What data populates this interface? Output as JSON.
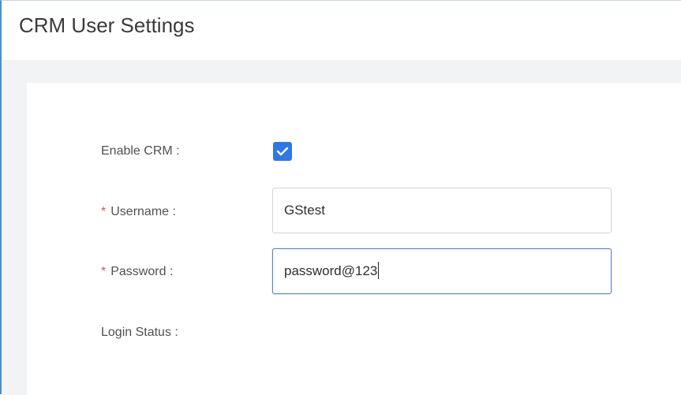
{
  "header": {
    "title": "CRM User Settings"
  },
  "form": {
    "enable_crm": {
      "label": "Enable CRM :",
      "checked": true
    },
    "username": {
      "required_mark": "*",
      "label": "Username :",
      "value": "GStest"
    },
    "password": {
      "required_mark": "*",
      "label": "Password :",
      "value": "password@123"
    },
    "login_status": {
      "label": "Login Status :"
    }
  },
  "colors": {
    "accent": "#2f78e4",
    "required": "#e05353",
    "focus_border": "#4f86c6",
    "left_border": "#4a90c8"
  }
}
